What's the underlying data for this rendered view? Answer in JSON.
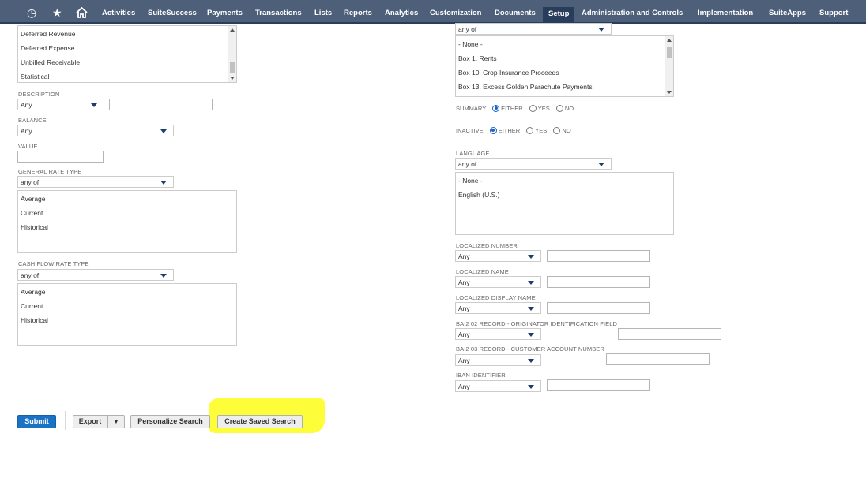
{
  "nav": {
    "items": [
      "Activities",
      "SuiteSuccess",
      "Payments",
      "Transactions",
      "Lists",
      "Reports",
      "Analytics",
      "Customization",
      "Documents",
      "Setup",
      "Administration and Controls",
      "Implementation",
      "SuiteApps",
      "Support"
    ],
    "active": "Setup"
  },
  "left": {
    "account_type_list": [
      "Deferred Revenue",
      "Deferred Expense",
      "Unbilled Receivable",
      "Statistical"
    ],
    "description": {
      "label": "DESCRIPTION",
      "operator": "Any",
      "value": ""
    },
    "balance": {
      "label": "BALANCE",
      "operator": "Any"
    },
    "value": {
      "label": "VALUE",
      "value": ""
    },
    "general_rate_type": {
      "label": "GENERAL RATE TYPE",
      "operator": "any of",
      "options": [
        "Average",
        "Current",
        "Historical"
      ]
    },
    "cash_flow_rate_type": {
      "label": "CASH FLOW RATE TYPE",
      "operator": "any of",
      "options": [
        "Average",
        "Current",
        "Historical"
      ]
    }
  },
  "right": {
    "top_select": {
      "operator": "any of",
      "options": [
        "- None -",
        "Box 1. Rents",
        "Box 10. Crop Insurance Proceeds",
        "Box 13. Excess Golden Parachute Payments"
      ]
    },
    "summary": {
      "label": "SUMMARY",
      "options": [
        "EITHER",
        "YES",
        "NO"
      ],
      "selected": "EITHER"
    },
    "inactive": {
      "label": "INACTIVE",
      "options": [
        "EITHER",
        "YES",
        "NO"
      ],
      "selected": "EITHER"
    },
    "language": {
      "label": "LANGUAGE",
      "operator": "any of",
      "options": [
        "- None -",
        "English (U.S.)"
      ]
    },
    "localized_number": {
      "label": "LOCALIZED NUMBER",
      "operator": "Any"
    },
    "localized_name": {
      "label": "LOCALIZED NAME",
      "operator": "Any"
    },
    "localized_display_name": {
      "label": "LOCALIZED DISPLAY NAME",
      "operator": "Any"
    },
    "bai2_02": {
      "label": "BAI2 02 RECORD - ORIGINATOR IDENTIFICATION FIELD",
      "operator": "Any"
    },
    "bai2_03": {
      "label": "BAI2 03 RECORD - CUSTOMER ACCOUNT NUMBER",
      "operator": "Any"
    },
    "iban": {
      "label": "IBAN IDENTIFIER",
      "operator": "Any"
    }
  },
  "buttons": {
    "submit": "Submit",
    "export": "Export",
    "export_arrow": "▼",
    "personalize": "Personalize Search",
    "create_saved": "Create Saved Search"
  },
  "icons": {
    "recent": "recent-icon",
    "star": "star-icon",
    "home": "home-icon"
  },
  "colors": {
    "nav_bg": "#4d5f79",
    "nav_active": "#283c5c",
    "primary": "#1a72c4",
    "highlight": "#fdfd3a",
    "radio_selected": "#1a63c6"
  }
}
